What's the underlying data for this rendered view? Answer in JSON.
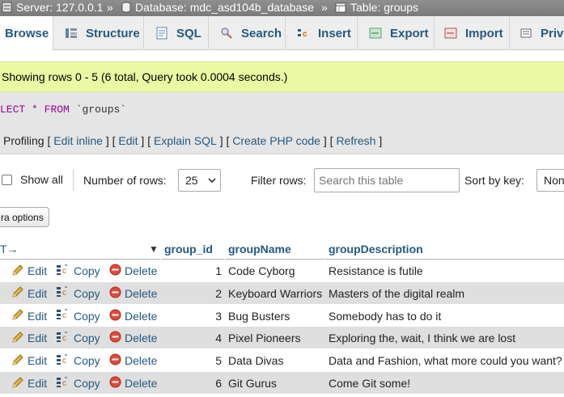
{
  "breadcrumb": {
    "server": "Server: 127.0.0.1",
    "database": "Database: mdc_asd104b_database",
    "table": "Table: groups",
    "separator": "»"
  },
  "tabs": [
    {
      "label": "Browse",
      "icon": "browse-icon"
    },
    {
      "label": "Structure",
      "icon": "structure-icon"
    },
    {
      "label": "SQL",
      "icon": "sql-icon"
    },
    {
      "label": "Search",
      "icon": "search-icon"
    },
    {
      "label": "Insert",
      "icon": "insert-icon"
    },
    {
      "label": "Export",
      "icon": "export-icon"
    },
    {
      "label": "Import",
      "icon": "import-icon"
    },
    {
      "label": "Priv",
      "icon": "privileges-icon"
    }
  ],
  "message": "Showing rows 0 - 5 (6 total, Query took 0.0004 seconds.)",
  "sql": {
    "prefix": "LECT",
    "star": "*",
    "from": "FROM",
    "table": "`groups`"
  },
  "profiling": {
    "label": "Profiling",
    "links": [
      "Edit inline",
      "Edit",
      "Explain SQL",
      "Create PHP code",
      "Refresh"
    ]
  },
  "navigation": {
    "show_all": "Show all",
    "rows_label": "Number of rows:",
    "rows_value": "25",
    "filter_label": "Filter rows:",
    "filter_placeholder": "Search this table",
    "sort_label": "Sort by key:",
    "sort_value": "Non"
  },
  "extra_options": "ra options",
  "table": {
    "arrows": "T→",
    "sort_arrow": "▼",
    "columns": [
      "group_id",
      "groupName",
      "groupDescription"
    ],
    "actions": {
      "edit": "Edit",
      "copy": "Copy",
      "delete": "Delete"
    },
    "rows": [
      {
        "group_id": "1",
        "groupName": "Code Cyborg",
        "groupDescription": "Resistance is futile"
      },
      {
        "group_id": "2",
        "groupName": "Keyboard Warriors",
        "groupDescription": "Masters of the digital realm"
      },
      {
        "group_id": "3",
        "groupName": "Bug Busters",
        "groupDescription": "Somebody has to do it"
      },
      {
        "group_id": "4",
        "groupName": "Pixel Pioneers",
        "groupDescription": "Exploring the, wait, I think we are lost"
      },
      {
        "group_id": "5",
        "groupName": "Data Divas",
        "groupDescription": "Data and Fashion, what more could you want?"
      },
      {
        "group_id": "6",
        "groupName": "Git Gurus",
        "groupDescription": "Come Git some!"
      }
    ]
  },
  "colors": {
    "link": "#235a81",
    "success_bg": "#ebf8a4",
    "row_alt": "#dfdfdf",
    "breadcrumb_bg": "#808080"
  }
}
